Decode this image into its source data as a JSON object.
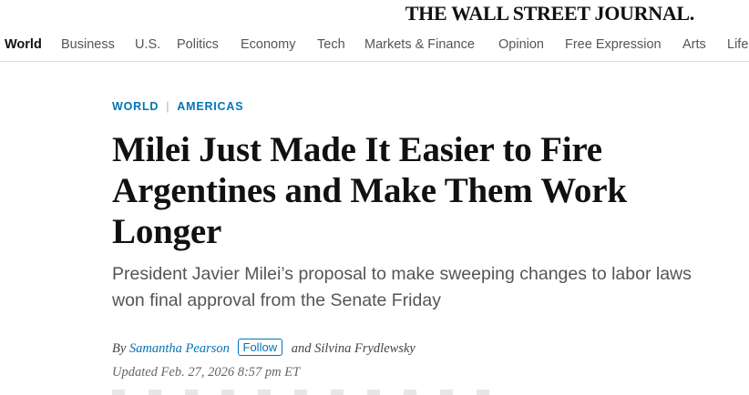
{
  "masthead": {
    "logo": "THE WALL STREET JOURNAL."
  },
  "nav": {
    "items": [
      {
        "label": "World",
        "active": true
      },
      {
        "label": "Business"
      },
      {
        "label": "U.S."
      },
      {
        "label": "Politics"
      },
      {
        "label": "Economy"
      },
      {
        "label": "Tech"
      },
      {
        "label": "Markets & Finance"
      },
      {
        "label": "Opinion"
      },
      {
        "label": "Free Expression"
      },
      {
        "label": "Arts"
      },
      {
        "label": "Life"
      }
    ]
  },
  "article": {
    "kicker": {
      "section": "WORLD",
      "separator": "|",
      "subsection": "AMERICAS"
    },
    "headline": "Milei Just Made It Easier to Fire Argentines and Make Them Work Longer",
    "dek": "President Javier Milei’s proposal to make sweeping changes to labor laws won final approval from the Senate Friday",
    "byline": {
      "prefix": "By",
      "author1": "Samantha Pearson",
      "follow_label": "Follow",
      "and_text": "and Silvina Frydlewsky"
    },
    "timestamp": "Updated Feb. 27, 2026 8:57 pm ET"
  },
  "colors": {
    "accent": "#0274b6",
    "headline": "#111111",
    "dek": "#555555"
  }
}
